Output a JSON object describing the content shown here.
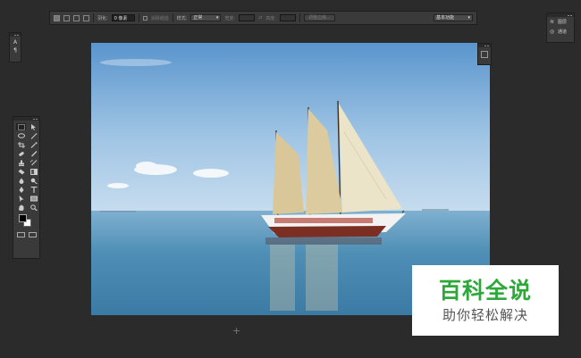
{
  "options_bar": {
    "feather_label": "羽化:",
    "feather_value": "0 像素",
    "antialias_label": "消除锯齿",
    "style_label": "样式:",
    "style_value": "正常",
    "width_label": "宽度:",
    "height_label": "高度:",
    "refine_edge_label": "调整边缘...",
    "workspace_value": "基本功能"
  },
  "right_panel": {
    "items": [
      {
        "icon": "layers-icon",
        "label": "图层"
      },
      {
        "icon": "channels-icon",
        "label": "通道"
      }
    ]
  },
  "toolbox": {
    "tools": [
      "marquee-icon",
      "move-icon",
      "lasso-icon",
      "magic-wand-icon",
      "crop-icon",
      "eyedropper-icon",
      "healing-brush-icon",
      "brush-icon",
      "clone-stamp-icon",
      "history-brush-icon",
      "eraser-icon",
      "gradient-icon",
      "blur-icon",
      "dodge-icon",
      "pen-icon",
      "type-icon",
      "path-selection-icon",
      "rectangle-icon",
      "hand-icon",
      "zoom-icon"
    ],
    "foreground_color": "#000000",
    "background_color": "#ffffff"
  },
  "canvas": {
    "image": "sailboat-photo"
  },
  "watermark": {
    "title": "百科全说",
    "subtitle": "助你轻松解决",
    "title_color": "#2fa83a"
  }
}
